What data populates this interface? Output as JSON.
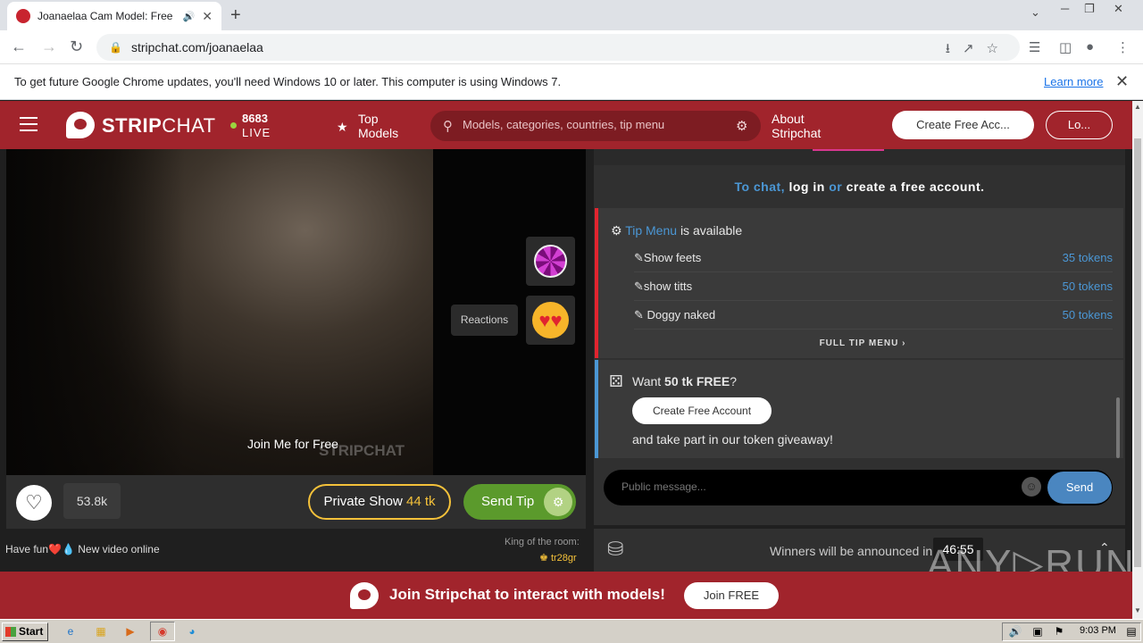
{
  "browser": {
    "tab_title": "Joanaelaa Cam Model: Free Live",
    "url": "stripchat.com/joanaelaa",
    "infobar_message": "To get future Google Chrome updates, you'll need Windows 10 or later. This computer is using Windows 7.",
    "infobar_link": "Learn more"
  },
  "header": {
    "logo_bold": "STRIP",
    "logo_light": "CHAT",
    "live_count": "8683",
    "live_label": "LIVE",
    "top_models_1": "Top",
    "top_models_2": "Models",
    "search_placeholder": "Models, categories, countries, tip menu",
    "about_1": "About",
    "about_2": "Stripchat",
    "create_account": "Create Free Acc...",
    "login": "Lo..."
  },
  "video": {
    "overlay_text": "Join Me for Free",
    "watermark": "STRIPCHAT",
    "reactions_label": "Reactions"
  },
  "controls": {
    "likes": "53.8k",
    "private_label": "Private Show",
    "private_price": "44 tk",
    "send_tip": "Send Tip"
  },
  "room": {
    "topic": "Have fun❤️💧 New video online",
    "king_label": "King of the room:",
    "king_name": "tr28gr"
  },
  "chat": {
    "login_prefix": "To chat,",
    "login_mid1": "log in",
    "login_mid2": "or",
    "login_suffix": "create a free account",
    "login_dot": ".",
    "tipmenu_link": "Tip Menu",
    "tipmenu_avail": "is available",
    "tip_items": [
      {
        "name": "Show feets",
        "price": "35 tokens"
      },
      {
        "name": "show titts",
        "price": "50 tokens"
      },
      {
        "name": "Doggy naked",
        "price": "50 tokens"
      }
    ],
    "full_tip_menu": "FULL TIP MENU ›",
    "want": "Want",
    "free_amount": "50 tk FREE",
    "qmark": "?",
    "create_free_account": "Create Free Account",
    "giveaway_text": "and take part in our token giveaway!",
    "message_placeholder": "Public message...",
    "send": "Send"
  },
  "winners": {
    "text": "Winners will be announced in",
    "time": "46:55"
  },
  "banner": {
    "text": "Join Stripchat to interact with models!",
    "join": "Join FREE"
  },
  "taskbar": {
    "start": "Start",
    "clock": "9:03 PM"
  },
  "watermark": {
    "text": "ANY▷RUN"
  }
}
